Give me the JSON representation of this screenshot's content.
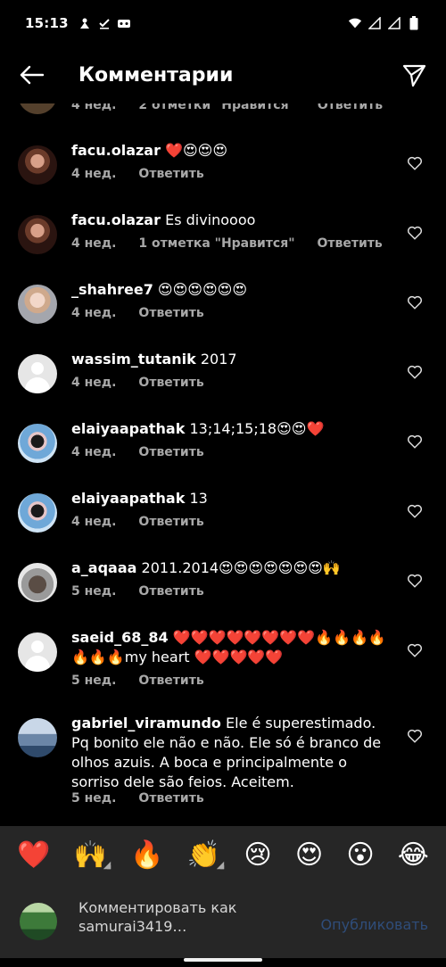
{
  "status_bar": {
    "time": "15:13"
  },
  "header": {
    "title": "Комментарии"
  },
  "partial_comment": {
    "time": "4 нед.",
    "likes": "2 отметки \"Нравится\"",
    "reply": "Ответить"
  },
  "comments": [
    {
      "username": "facu.olazar",
      "text": "❤️😍😍😍",
      "time": "4 нед.",
      "likes": "",
      "reply": "Ответить"
    },
    {
      "username": "facu.olazar",
      "text": "Es divinoooo",
      "time": "4 нед.",
      "likes": "1 отметка \"Нравится\"",
      "reply": "Ответить"
    },
    {
      "username": "_shahree7",
      "text": "😍😍😍😍😍😍",
      "time": "4 нед.",
      "likes": "",
      "reply": "Ответить"
    },
    {
      "username": "wassim_tutanik",
      "text": "2017",
      "time": "4 нед.",
      "likes": "",
      "reply": "Ответить"
    },
    {
      "username": "elaiyaapathak",
      "text": "13;14;15;18😍😍❤️",
      "time": "4 нед.",
      "likes": "",
      "reply": "Ответить"
    },
    {
      "username": "elaiyaapathak",
      "text": "13",
      "time": "4 нед.",
      "likes": "",
      "reply": "Ответить"
    },
    {
      "username": "a_aqaaa",
      "text": "2011.2014😍😍😍😍😍😍😍🙌",
      "time": "5 нед.",
      "likes": "",
      "reply": "Ответить"
    },
    {
      "username": "saeid_68_84",
      "text": "❤️❤️❤️❤️❤️❤️❤️❤️🔥🔥🔥🔥🔥🔥🔥my heart ❤️❤️❤️❤️❤️",
      "time": "5 нед.",
      "likes": "",
      "reply": "Ответить"
    },
    {
      "username": "gabriel_viramundo",
      "text": "Ele é superestimado. Pq bonito ele não e não. Ele só é branco de olhos azuis. A boca e principalmente o sorriso dele são feios. Aceitem.",
      "time": "5 нед.",
      "likes": "",
      "reply": "Ответить"
    }
  ],
  "emoji_bar": [
    "❤️",
    "🙌",
    "🔥",
    "👏",
    "😢",
    "😍",
    "😮",
    "😂"
  ],
  "composer": {
    "placeholder": "Комментировать как samurai3419…",
    "publish": "Опубликовать"
  }
}
